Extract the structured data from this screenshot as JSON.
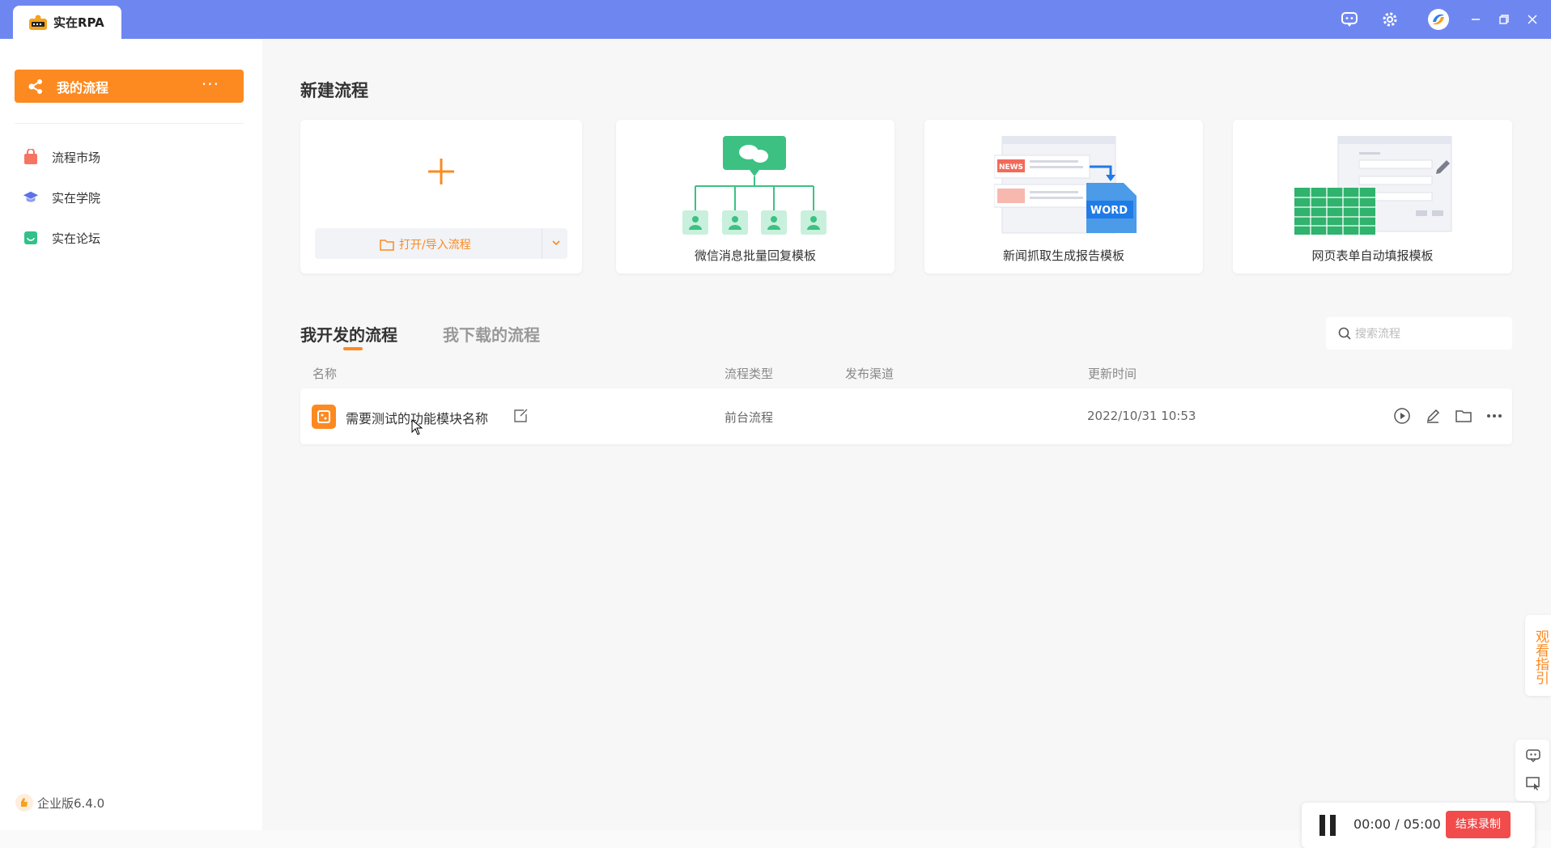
{
  "window": {
    "app_tab_label": "实在RPA",
    "accent": "#fc8a21",
    "titlebar_color": "#6e87f0",
    "icons": [
      "chat-icon",
      "gear-icon",
      "account-avatar-icon",
      "minimize-icon",
      "restore-icon",
      "close-icon"
    ]
  },
  "sidebar": {
    "primary": {
      "label": "我的流程",
      "more": "···"
    },
    "items": [
      {
        "label": "流程市场",
        "icon": "shopping-bag-icon",
        "color": "#f57462"
      },
      {
        "label": "实在学院",
        "icon": "graduation-cap-icon",
        "color": "#5d72e8"
      },
      {
        "label": "实在论坛",
        "icon": "forum-icon",
        "color": "#33c08a"
      }
    ],
    "version": "企业版6.4.0"
  },
  "new_flow": {
    "title": "新建流程",
    "open_import_label": "打开/导入流程",
    "templates": [
      {
        "label": "微信消息批量回复模板",
        "illustration": "wechat-org-illustration"
      },
      {
        "label": "新闻抓取生成报告模板",
        "illustration": "news-to-word-illustration"
      },
      {
        "label": "网页表单自动填报模板",
        "illustration": "web-form-sheet-illustration"
      }
    ]
  },
  "flows": {
    "tabs": [
      {
        "label": "我开发的流程",
        "active": true
      },
      {
        "label": "我下载的流程",
        "active": false
      }
    ],
    "search_placeholder": "搜索流程",
    "columns": {
      "name": "名称",
      "type": "流程类型",
      "channel": "发布渠道",
      "updated": "更新时间"
    },
    "rows": [
      {
        "name": "需要测试的功能模块名称",
        "type": "前台流程",
        "channel": "",
        "updated": "2022/10/31 10:53"
      }
    ]
  },
  "guide_label": "观看指引",
  "recorder": {
    "elapsed": "00:00",
    "separator": "/",
    "limit": "05:00",
    "stop_label": "结束录制"
  }
}
